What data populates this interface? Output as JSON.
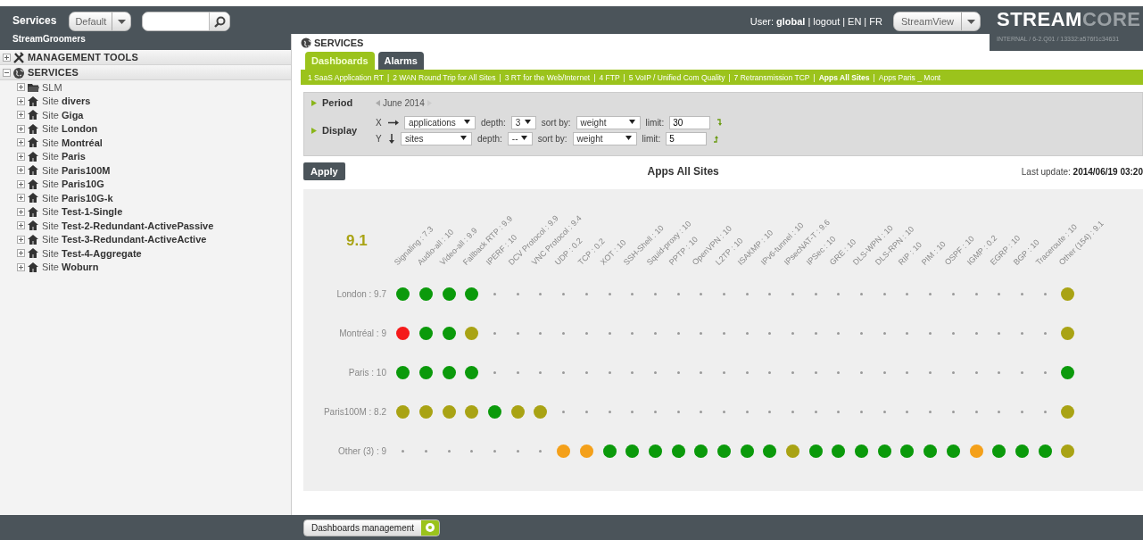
{
  "header": {
    "title": "Services",
    "view_select": "Default",
    "user_label": "User:",
    "user_name": "global",
    "separator": "|",
    "links": [
      "logout",
      "EN",
      "FR"
    ],
    "app_select": "StreamView",
    "logo": {
      "strong": "STREAM",
      "light": "CORE"
    },
    "version": "INTERNAL / 6-2.Q01 / 13332:a576f1c34631"
  },
  "sidebar": {
    "title": "StreamGroomers",
    "tree": [
      {
        "label": "MANAGEMENT TOOLS",
        "kind": "tools",
        "expanded": false
      },
      {
        "label": "SERVICES",
        "kind": "globe",
        "expanded": true,
        "children": [
          {
            "label": "SLM",
            "kind": "folder",
            "expanded": false
          },
          {
            "label": "Site **divers**",
            "kind": "site",
            "expanded": false
          },
          {
            "label": "Site **Giga**",
            "kind": "site",
            "expanded": false
          },
          {
            "label": "Site **London**",
            "kind": "site",
            "expanded": false
          },
          {
            "label": "Site **Montréal**",
            "kind": "site",
            "expanded": false
          },
          {
            "label": "Site **Paris**",
            "kind": "site",
            "expanded": false
          },
          {
            "label": "Site **Paris100M**",
            "kind": "site",
            "expanded": false
          },
          {
            "label": "Site **Paris10G**",
            "kind": "site",
            "expanded": false
          },
          {
            "label": "Site **Paris10G-k**",
            "kind": "site",
            "expanded": false
          },
          {
            "label": "Site **Test-1-Single**",
            "kind": "site",
            "expanded": false
          },
          {
            "label": "Site **Test-2-Redundant-ActivePassive**",
            "kind": "site",
            "expanded": false
          },
          {
            "label": "Site **Test-3-Redundant-ActiveActive**",
            "kind": "site",
            "expanded": false
          },
          {
            "label": "Site **Test-4-Aggregate**",
            "kind": "site",
            "expanded": false
          },
          {
            "label": "Site **Woburn**",
            "kind": "site",
            "expanded": false
          }
        ]
      }
    ]
  },
  "main": {
    "title": "SERVICES",
    "tabs": [
      {
        "label": "Dashboards",
        "selected": true
      },
      {
        "label": "Alarms",
        "selected": false
      }
    ],
    "separator": "|",
    "dashboards": [
      {
        "label": "1 SaaS Application RT",
        "selected": false
      },
      {
        "label": "2 WAN Round Trip for All Sites",
        "selected": false
      },
      {
        "label": "3 RT for the Web/Internet",
        "selected": false
      },
      {
        "label": "4 FTP",
        "selected": false
      },
      {
        "label": "5 VoIP / Unified Com Quality",
        "selected": false
      },
      {
        "label": "7 Retransmission TCP",
        "selected": false
      },
      {
        "label": "Apps All Sites",
        "selected": true
      },
      {
        "label": "Apps Paris _ Mont",
        "selected": false
      }
    ],
    "period": {
      "label": "Period",
      "value": "June 2014"
    },
    "display": {
      "label": "Display",
      "axes": [
        {
          "axis": "X",
          "kind": "horizontal",
          "field": "applications",
          "depth_label": "depth:",
          "depth": "3",
          "sort_label": "sort by:",
          "sort": "weight",
          "limit_label": "limit:",
          "limit": "30"
        },
        {
          "axis": "Y",
          "kind": "vertical",
          "field": "sites",
          "depth_label": "depth:",
          "depth": "--",
          "sort_label": "sort by:",
          "sort": "weight",
          "limit_label": "limit:",
          "limit": "5"
        }
      ]
    },
    "apply": "Apply",
    "chart_title": "Apps All Sites",
    "last_update_label": "Last update:",
    "last_update": "2014/06/19 03:20"
  },
  "matrix": {
    "score": "9.1",
    "columns": [
      "Signaling : 7.3",
      "Audio-all : 10",
      "Video-all : 9.9",
      "Fallback RTP : 9.9",
      "IPERF : 10",
      "DCV Protocol : 9.9",
      "VNC Protocol : 9.4",
      "UDP : 0.2",
      "TCP : 0.2",
      "XOT : 10",
      "SSH-Shell : 10",
      "Squid-proxy : 10",
      "PPTP : 10",
      "OpenVPN : 10",
      "L2TP : 10",
      "ISAKMP : 10",
      "IPv6-tunnel : 10",
      "IPsecNAT-T : 9.6",
      "IPSec : 10",
      "GRE : 10",
      "DLS-WPN : 10",
      "DLS-RPN : 10",
      "RIP : 10",
      "PIM : 10",
      "OSPF : 10",
      "IGMP : 0.2",
      "EGRP : 10",
      "BGP : 10",
      "Traceroute : 10",
      "Other (154) : 9.1"
    ],
    "rows": [
      {
        "label": "London : 9.7",
        "cells": [
          {
            "kind": "dot",
            "color": "#0b9a0b"
          },
          {
            "kind": "dot",
            "color": "#0b9a0b"
          },
          {
            "kind": "dot",
            "color": "#0b9a0b"
          },
          {
            "kind": "dot",
            "color": "#0b9a0b"
          },
          {
            "kind": "empty"
          },
          {
            "kind": "empty"
          },
          {
            "kind": "empty"
          },
          {
            "kind": "empty"
          },
          {
            "kind": "empty"
          },
          {
            "kind": "empty"
          },
          {
            "kind": "empty"
          },
          {
            "kind": "empty"
          },
          {
            "kind": "empty"
          },
          {
            "kind": "empty"
          },
          {
            "kind": "empty"
          },
          {
            "kind": "empty"
          },
          {
            "kind": "empty"
          },
          {
            "kind": "empty"
          },
          {
            "kind": "empty"
          },
          {
            "kind": "empty"
          },
          {
            "kind": "empty"
          },
          {
            "kind": "empty"
          },
          {
            "kind": "empty"
          },
          {
            "kind": "empty"
          },
          {
            "kind": "empty"
          },
          {
            "kind": "empty"
          },
          {
            "kind": "empty"
          },
          {
            "kind": "empty"
          },
          {
            "kind": "empty"
          },
          {
            "kind": "dot",
            "color": "#a9a314"
          }
        ]
      },
      {
        "label": "Montréal : 9",
        "cells": [
          {
            "kind": "dot",
            "color": "#f51a1a"
          },
          {
            "kind": "dot",
            "color": "#0b9a0b"
          },
          {
            "kind": "dot",
            "color": "#0b9a0b"
          },
          {
            "kind": "dot",
            "color": "#a9a314"
          },
          {
            "kind": "empty"
          },
          {
            "kind": "empty"
          },
          {
            "kind": "empty"
          },
          {
            "kind": "empty"
          },
          {
            "kind": "empty"
          },
          {
            "kind": "empty"
          },
          {
            "kind": "empty"
          },
          {
            "kind": "empty"
          },
          {
            "kind": "empty"
          },
          {
            "kind": "empty"
          },
          {
            "kind": "empty"
          },
          {
            "kind": "empty"
          },
          {
            "kind": "empty"
          },
          {
            "kind": "empty"
          },
          {
            "kind": "empty"
          },
          {
            "kind": "empty"
          },
          {
            "kind": "empty"
          },
          {
            "kind": "empty"
          },
          {
            "kind": "empty"
          },
          {
            "kind": "empty"
          },
          {
            "kind": "empty"
          },
          {
            "kind": "empty"
          },
          {
            "kind": "empty"
          },
          {
            "kind": "empty"
          },
          {
            "kind": "empty"
          },
          {
            "kind": "dot",
            "color": "#a9a314"
          }
        ]
      },
      {
        "label": "Paris : 10",
        "cells": [
          {
            "kind": "dot",
            "color": "#0b9a0b"
          },
          {
            "kind": "dot",
            "color": "#0b9a0b"
          },
          {
            "kind": "dot",
            "color": "#0b9a0b"
          },
          {
            "kind": "dot",
            "color": "#0b9a0b"
          },
          {
            "kind": "empty"
          },
          {
            "kind": "empty"
          },
          {
            "kind": "empty"
          },
          {
            "kind": "empty"
          },
          {
            "kind": "empty"
          },
          {
            "kind": "empty"
          },
          {
            "kind": "empty"
          },
          {
            "kind": "empty"
          },
          {
            "kind": "empty"
          },
          {
            "kind": "empty"
          },
          {
            "kind": "empty"
          },
          {
            "kind": "empty"
          },
          {
            "kind": "empty"
          },
          {
            "kind": "empty"
          },
          {
            "kind": "empty"
          },
          {
            "kind": "empty"
          },
          {
            "kind": "empty"
          },
          {
            "kind": "empty"
          },
          {
            "kind": "empty"
          },
          {
            "kind": "empty"
          },
          {
            "kind": "empty"
          },
          {
            "kind": "empty"
          },
          {
            "kind": "empty"
          },
          {
            "kind": "empty"
          },
          {
            "kind": "empty"
          },
          {
            "kind": "dot",
            "color": "#0b9a0b"
          }
        ]
      },
      {
        "label": "Paris100M : 8.2",
        "cells": [
          {
            "kind": "dot",
            "color": "#a9a314"
          },
          {
            "kind": "dot",
            "color": "#a9a314"
          },
          {
            "kind": "dot",
            "color": "#a9a314"
          },
          {
            "kind": "dot",
            "color": "#a9a314"
          },
          {
            "kind": "dot",
            "color": "#0b9a0b"
          },
          {
            "kind": "dot",
            "color": "#a9a314"
          },
          {
            "kind": "dot",
            "color": "#a9a314"
          },
          {
            "kind": "empty"
          },
          {
            "kind": "empty"
          },
          {
            "kind": "empty"
          },
          {
            "kind": "empty"
          },
          {
            "kind": "empty"
          },
          {
            "kind": "empty"
          },
          {
            "kind": "empty"
          },
          {
            "kind": "empty"
          },
          {
            "kind": "empty"
          },
          {
            "kind": "empty"
          },
          {
            "kind": "empty"
          },
          {
            "kind": "empty"
          },
          {
            "kind": "empty"
          },
          {
            "kind": "empty"
          },
          {
            "kind": "empty"
          },
          {
            "kind": "empty"
          },
          {
            "kind": "empty"
          },
          {
            "kind": "empty"
          },
          {
            "kind": "empty"
          },
          {
            "kind": "empty"
          },
          {
            "kind": "empty"
          },
          {
            "kind": "empty"
          },
          {
            "kind": "dot",
            "color": "#a9a314"
          }
        ]
      },
      {
        "label": "Other (3) : 9",
        "cells": [
          {
            "kind": "empty"
          },
          {
            "kind": "empty"
          },
          {
            "kind": "empty"
          },
          {
            "kind": "empty"
          },
          {
            "kind": "empty"
          },
          {
            "kind": "empty"
          },
          {
            "kind": "empty"
          },
          {
            "kind": "dot",
            "color": "#f4a01a"
          },
          {
            "kind": "dot",
            "color": "#f4a01a"
          },
          {
            "kind": "dot",
            "color": "#0b9a0b"
          },
          {
            "kind": "dot",
            "color": "#0b9a0b"
          },
          {
            "kind": "dot",
            "color": "#0b9a0b"
          },
          {
            "kind": "dot",
            "color": "#0b9a0b"
          },
          {
            "kind": "dot",
            "color": "#0b9a0b"
          },
          {
            "kind": "dot",
            "color": "#0b9a0b"
          },
          {
            "kind": "dot",
            "color": "#0b9a0b"
          },
          {
            "kind": "dot",
            "color": "#0b9a0b"
          },
          {
            "kind": "dot",
            "color": "#a9a314"
          },
          {
            "kind": "dot",
            "color": "#0b9a0b"
          },
          {
            "kind": "dot",
            "color": "#0b9a0b"
          },
          {
            "kind": "dot",
            "color": "#0b9a0b"
          },
          {
            "kind": "dot",
            "color": "#0b9a0b"
          },
          {
            "kind": "dot",
            "color": "#0b9a0b"
          },
          {
            "kind": "dot",
            "color": "#0b9a0b"
          },
          {
            "kind": "dot",
            "color": "#0b9a0b"
          },
          {
            "kind": "dot",
            "color": "#f4a01a"
          },
          {
            "kind": "dot",
            "color": "#0b9a0b"
          },
          {
            "kind": "dot",
            "color": "#0b9a0b"
          },
          {
            "kind": "dot",
            "color": "#0b9a0b"
          },
          {
            "kind": "dot",
            "color": "#a9a314"
          }
        ]
      }
    ]
  },
  "footer": {
    "button": "Dashboards management"
  }
}
